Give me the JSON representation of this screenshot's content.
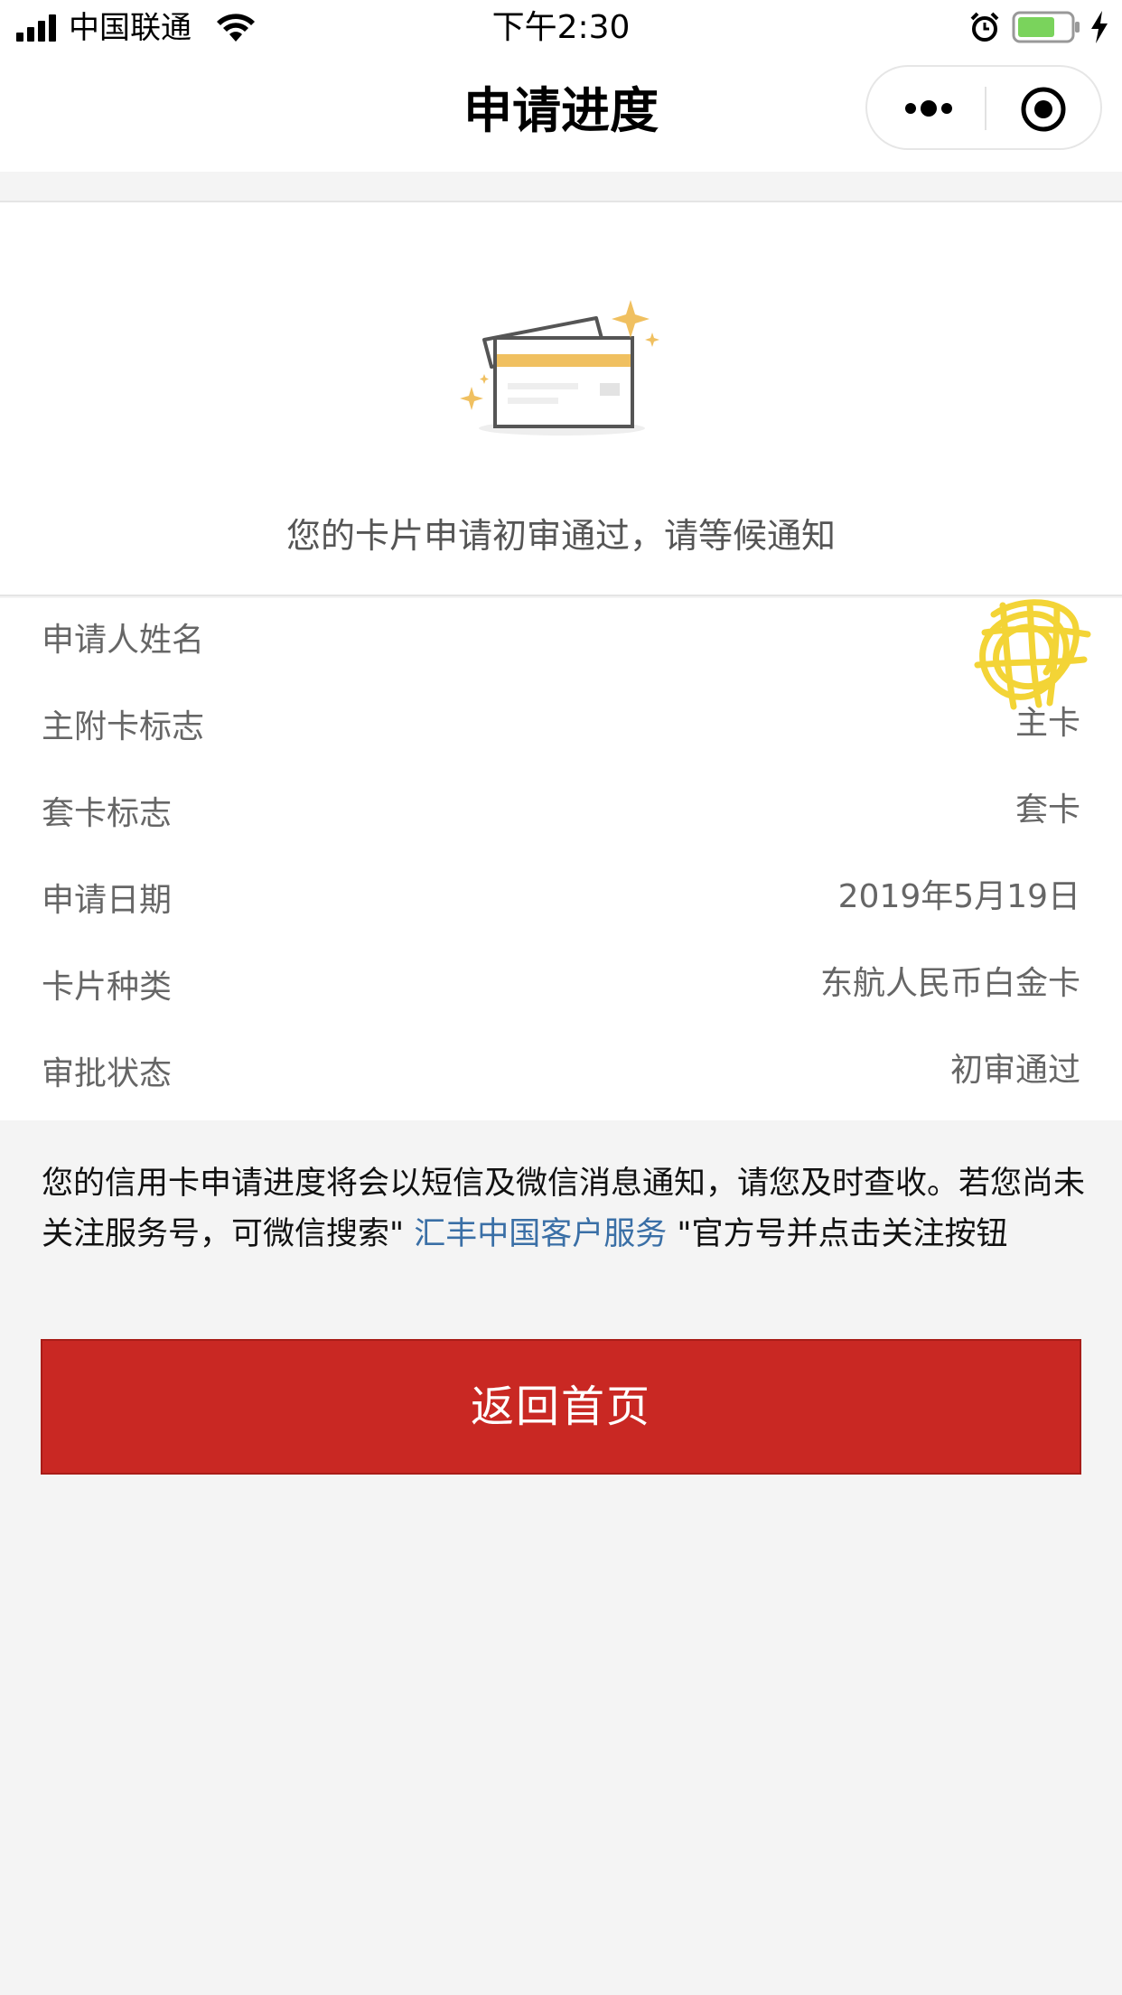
{
  "status_bar": {
    "carrier": "中国联通",
    "time": "下午2:30"
  },
  "nav": {
    "title": "申请进度"
  },
  "hero": {
    "message": "您的卡片申请初审通过，请等候通知"
  },
  "info_rows": [
    {
      "label": "申请人姓名",
      "value": ""
    },
    {
      "label": "主附卡标志",
      "value": "主卡"
    },
    {
      "label": "套卡标志",
      "value": "套卡"
    },
    {
      "label": "申请日期",
      "value": "2019年5月19日"
    },
    {
      "label": "卡片种类",
      "value": "东航人民币白金卡"
    },
    {
      "label": "审批状态",
      "value": "初审通过"
    }
  ],
  "notice": {
    "text_before": "您的信用卡申请进度将会以短信及微信消息通知，请您及时查收。若您尚未关注服务号，可微信搜索\"",
    "link_text": " 汇丰中国客户服务 ",
    "text_after": "\"官方号并点击关注按钮"
  },
  "button": {
    "label": "返回首页"
  },
  "colors": {
    "accent_red": "#c92823",
    "link_blue": "#3a6fa6",
    "illustration_gold": "#f0c060",
    "battery_green": "#7ad35c"
  }
}
